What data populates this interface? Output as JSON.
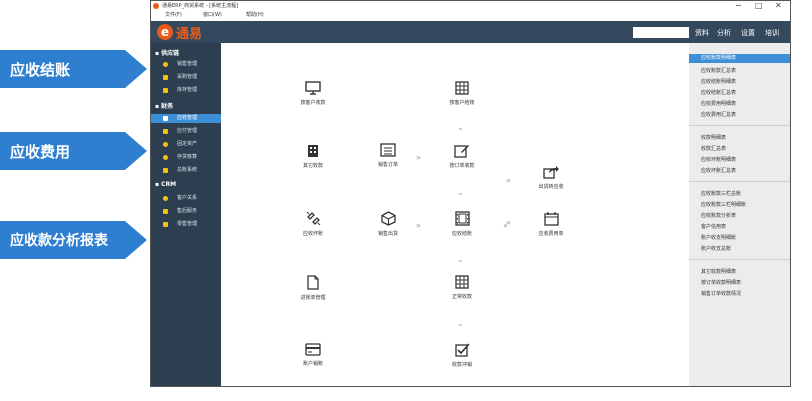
{
  "callouts": [
    "应收结账",
    "应收费用",
    "应收款分析报表"
  ],
  "window": {
    "title": "通易ERP_商贸系统 - [系统主流程]",
    "menu": [
      "文件(F)",
      "窗口(W)",
      "帮助(H)"
    ],
    "logo_letter": "e",
    "logo_text": "通易",
    "controls": [
      "−",
      "□",
      "✕"
    ]
  },
  "topnav": [
    "资料",
    "分析",
    "设置",
    "培训"
  ],
  "sidebar": {
    "groups": [
      {
        "label": "供应链",
        "items": [
          "销售管理",
          "采购管理",
          "库存管理"
        ]
      },
      {
        "label": "财务",
        "items": [
          "应收管理",
          "应付管理",
          "固定资产",
          "存货核算",
          "总账系统"
        ]
      },
      {
        "label": "CRM",
        "items": [
          "客户关系",
          "售后服务",
          "零售管理"
        ]
      }
    ],
    "active": "应收管理"
  },
  "flow": {
    "nodes": {
      "by_customer_receipt": "按客户收款",
      "by_customer_settle": "按客户结账",
      "other_receipt": "其它收款",
      "sales_order": "销售订单",
      "by_order_receipt": "按订单收款",
      "shipping_to_receivable": "出货转应收",
      "receivable_writeoff": "应收坏账",
      "sales_outbound": "销售出货",
      "receivable_settle": "应收结账",
      "receivable_fee": "应收费用单",
      "advance_management": "进账单管理",
      "normal_receipt": "正常收款",
      "account_offset": "账户销账",
      "receipt_offset": "收款冲销"
    }
  },
  "right_panel": {
    "groups": [
      [
        "应收账款明细表",
        "应收账款汇总表",
        "应收结账明细表",
        "应收结账汇总表",
        "应收费用明细表",
        "应收费用汇总表"
      ],
      [
        "收款明细表",
        "收款汇总表",
        "应收坏账明细表",
        "应收坏账汇总表"
      ],
      [
        "应收账款三栏总账",
        "应收账款三栏明细账",
        "应收账款分析表",
        "客户信用表",
        "账户收支明细账",
        "账户收支总账"
      ],
      [
        "其它收款明细表",
        "按订单收款明细表",
        "销售订单收款情况"
      ]
    ],
    "active": "应收账款明细表"
  },
  "colors": {
    "accent": "#3d8fd8",
    "callout": "#2f7fd0",
    "header": "#34495e",
    "sidebar": "#2c3e50",
    "logo": "#e85c1a"
  }
}
